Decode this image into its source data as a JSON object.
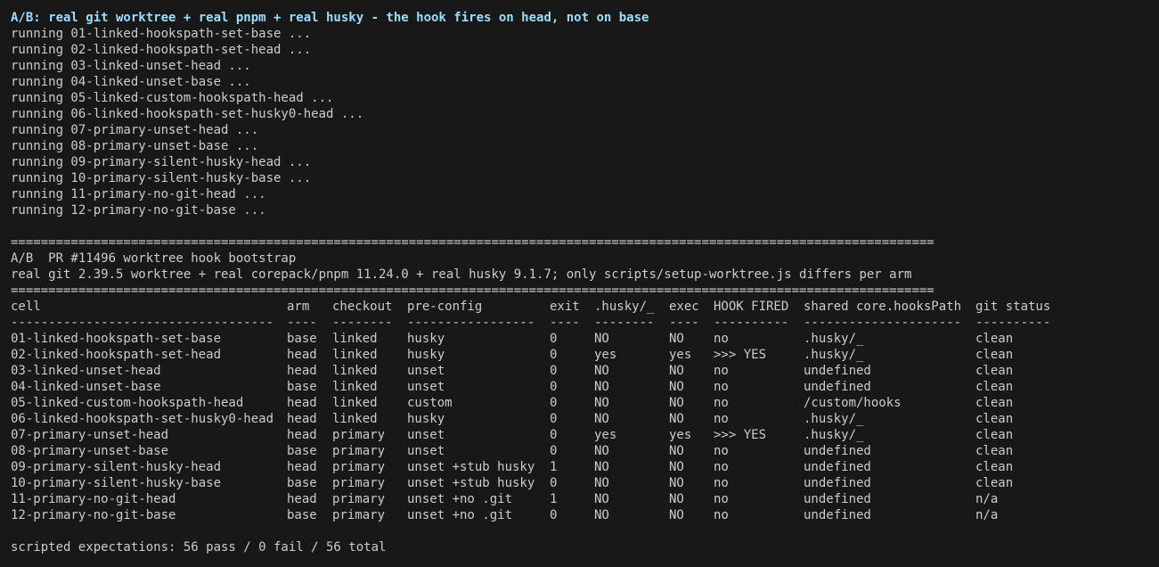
{
  "title": "A/B: real git worktree + real pnpm + real husky - the hook fires on head, not on base",
  "running": [
    "running 01-linked-hookspath-set-base ...",
    "running 02-linked-hookspath-set-head ...",
    "running 03-linked-unset-head ...",
    "running 04-linked-unset-base ...",
    "running 05-linked-custom-hookspath-head ...",
    "running 06-linked-hookspath-set-husky0-head ...",
    "running 07-primary-unset-head ...",
    "running 08-primary-unset-base ...",
    "running 09-primary-silent-husky-head ...",
    "running 10-primary-silent-husky-base ...",
    "running 11-primary-no-git-head ...",
    "running 12-primary-no-git-base ..."
  ],
  "separator": "===========================================================================================================================",
  "header": {
    "line1": "A/B  PR #11496 worktree hook bootstrap",
    "line2": "real git 2.39.5 worktree + real corepack/pnpm 11.24.0 + real husky 9.1.7; only scripts/setup-worktree.js differs per arm"
  },
  "table": {
    "columns": [
      "cell",
      "arm",
      "checkout",
      "pre-config",
      "exit",
      ".husky/_",
      "exec",
      "HOOK FIRED",
      "shared core.hooksPath",
      "git status"
    ],
    "dashes": [
      "-----------------------------------",
      "----",
      "--------",
      "-----------------",
      "----",
      "--------",
      "----",
      "----------",
      "---------------------",
      "----------"
    ],
    "rows": [
      [
        "01-linked-hookspath-set-base",
        "base",
        "linked",
        "husky",
        "0",
        "NO",
        "NO",
        "no",
        ".husky/_",
        "clean"
      ],
      [
        "02-linked-hookspath-set-head",
        "head",
        "linked",
        "husky",
        "0",
        "yes",
        "yes",
        ">>> YES",
        ".husky/_",
        "clean"
      ],
      [
        "03-linked-unset-head",
        "head",
        "linked",
        "unset",
        "0",
        "NO",
        "NO",
        "no",
        "undefined",
        "clean"
      ],
      [
        "04-linked-unset-base",
        "base",
        "linked",
        "unset",
        "0",
        "NO",
        "NO",
        "no",
        "undefined",
        "clean"
      ],
      [
        "05-linked-custom-hookspath-head",
        "head",
        "linked",
        "custom",
        "0",
        "NO",
        "NO",
        "no",
        "/custom/hooks",
        "clean"
      ],
      [
        "06-linked-hookspath-set-husky0-head",
        "head",
        "linked",
        "husky",
        "0",
        "NO",
        "NO",
        "no",
        ".husky/_",
        "clean"
      ],
      [
        "07-primary-unset-head",
        "head",
        "primary",
        "unset",
        "0",
        "yes",
        "yes",
        ">>> YES",
        ".husky/_",
        "clean"
      ],
      [
        "08-primary-unset-base",
        "base",
        "primary",
        "unset",
        "0",
        "NO",
        "NO",
        "no",
        "undefined",
        "clean"
      ],
      [
        "09-primary-silent-husky-head",
        "head",
        "primary",
        "unset +stub husky",
        "1",
        "NO",
        "NO",
        "no",
        "undefined",
        "clean"
      ],
      [
        "10-primary-silent-husky-base",
        "base",
        "primary",
        "unset +stub husky",
        "0",
        "NO",
        "NO",
        "no",
        "undefined",
        "clean"
      ],
      [
        "11-primary-no-git-head",
        "head",
        "primary",
        "unset +no .git",
        "1",
        "NO",
        "NO",
        "no",
        "undefined",
        "n/a"
      ],
      [
        "12-primary-no-git-base",
        "base",
        "primary",
        "unset +no .git",
        "0",
        "NO",
        "NO",
        "no",
        "undefined",
        "n/a"
      ]
    ]
  },
  "summary": "scripted expectations: 56 pass / 0 fail / 56 total"
}
